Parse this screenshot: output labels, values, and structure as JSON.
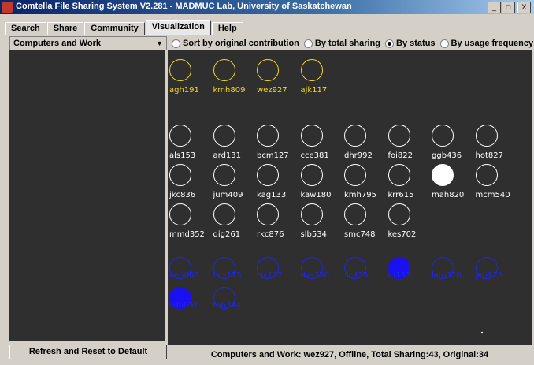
{
  "window": {
    "title": "Comtella File Sharing System V2.281 - MADMUC Lab, University of Saskatchewan",
    "controls": [
      "_",
      "□",
      "X"
    ]
  },
  "tabs": [
    "Search",
    "Share",
    "Community",
    "Visualization",
    "Help"
  ],
  "active_tab": "Visualization",
  "community_select": {
    "value": "Computers and Work"
  },
  "sort_options": [
    {
      "label": "Sort by original contribution",
      "selected": false
    },
    {
      "label": "By total sharing",
      "selected": false
    },
    {
      "label": "By status",
      "selected": true
    },
    {
      "label": "By usage frequency",
      "selected": false
    }
  ],
  "refresh_label": "Refresh and Reset to Default",
  "status_text": "Computers and Work: wez927, Offline, Total Sharing:43, Original:34",
  "colors": {
    "yellow": "#f2d81b",
    "white": "#ffffff",
    "blue": "#2026e6",
    "canvas": "#2f2f2f"
  },
  "users": {
    "yellow": [
      {
        "name": "agh191",
        "filled": false
      },
      {
        "name": "kmh809",
        "filled": false
      },
      {
        "name": "wez927",
        "filled": false
      },
      {
        "name": "ajk117",
        "filled": false
      }
    ],
    "white": [
      {
        "name": "als153",
        "filled": false
      },
      {
        "name": "ard131",
        "filled": false
      },
      {
        "name": "bcm127",
        "filled": false
      },
      {
        "name": "cce381",
        "filled": false
      },
      {
        "name": "dhr992",
        "filled": false
      },
      {
        "name": "foi822",
        "filled": false
      },
      {
        "name": "ggb436",
        "filled": false
      },
      {
        "name": "hot827",
        "filled": false
      },
      {
        "name": "jkc836",
        "filled": false
      },
      {
        "name": "jum409",
        "filled": false
      },
      {
        "name": "kag133",
        "filled": false
      },
      {
        "name": "kaw180",
        "filled": false
      },
      {
        "name": "kmh795",
        "filled": false
      },
      {
        "name": "krr615",
        "filled": false
      },
      {
        "name": "mah820",
        "filled": true
      },
      {
        "name": "mcm540",
        "filled": false
      },
      {
        "name": "mmd352",
        "filled": false
      },
      {
        "name": "qig261",
        "filled": false
      },
      {
        "name": "rkc876",
        "filled": false
      },
      {
        "name": "slb534",
        "filled": false
      },
      {
        "name": "smc748",
        "filled": false
      },
      {
        "name": "kes702",
        "filled": false
      }
    ],
    "blue": [
      {
        "name": "aeh063",
        "filled": false
      },
      {
        "name": "bcs175",
        "filled": false
      },
      {
        "name": "cjc132",
        "filled": false
      },
      {
        "name": "dvs350",
        "filled": false
      },
      {
        "name": "ilc435",
        "filled": false
      },
      {
        "name": "iri133",
        "filled": true
      },
      {
        "name": "lam320",
        "filled": false
      },
      {
        "name": "jap173",
        "filled": false
      },
      {
        "name": "sdh051",
        "filled": true
      },
      {
        "name": "tab344",
        "filled": false
      }
    ]
  }
}
